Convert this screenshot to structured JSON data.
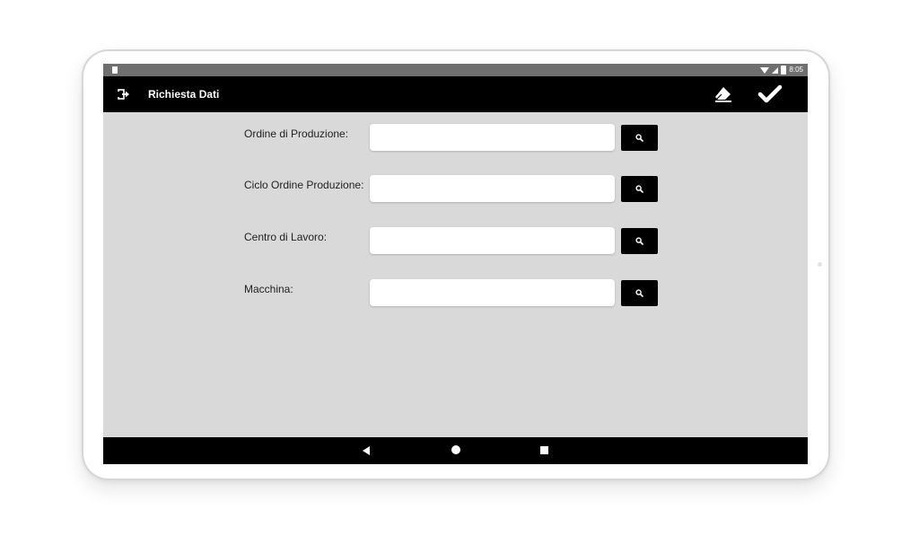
{
  "status_bar": {
    "time": "8:05",
    "icons": [
      "sd-card-icon",
      "wifi-icon",
      "signal-icon",
      "battery-icon"
    ]
  },
  "app_bar": {
    "title": "Richiesta Dati",
    "icons": [
      "exit-icon",
      "eraser-icon",
      "check-icon"
    ]
  },
  "form": {
    "fields": [
      {
        "label": "Ordine di Produzione:",
        "value": "",
        "placeholder": ""
      },
      {
        "label": "Ciclo Ordine Produzione:",
        "value": "",
        "placeholder": ""
      },
      {
        "label": "Centro di Lavoro:",
        "value": "",
        "placeholder": ""
      },
      {
        "label": "Macchina:",
        "value": "",
        "placeholder": ""
      }
    ],
    "search_icon": "search-icon"
  },
  "nav_bar": {
    "icons": [
      "back-icon",
      "home-icon",
      "recents-icon"
    ]
  },
  "colors": {
    "screen_background": "#d9d9d9",
    "app_bar": "#000000",
    "status_bar": "#6f6f6f",
    "input_background": "#ffffff",
    "button": "#000000"
  }
}
